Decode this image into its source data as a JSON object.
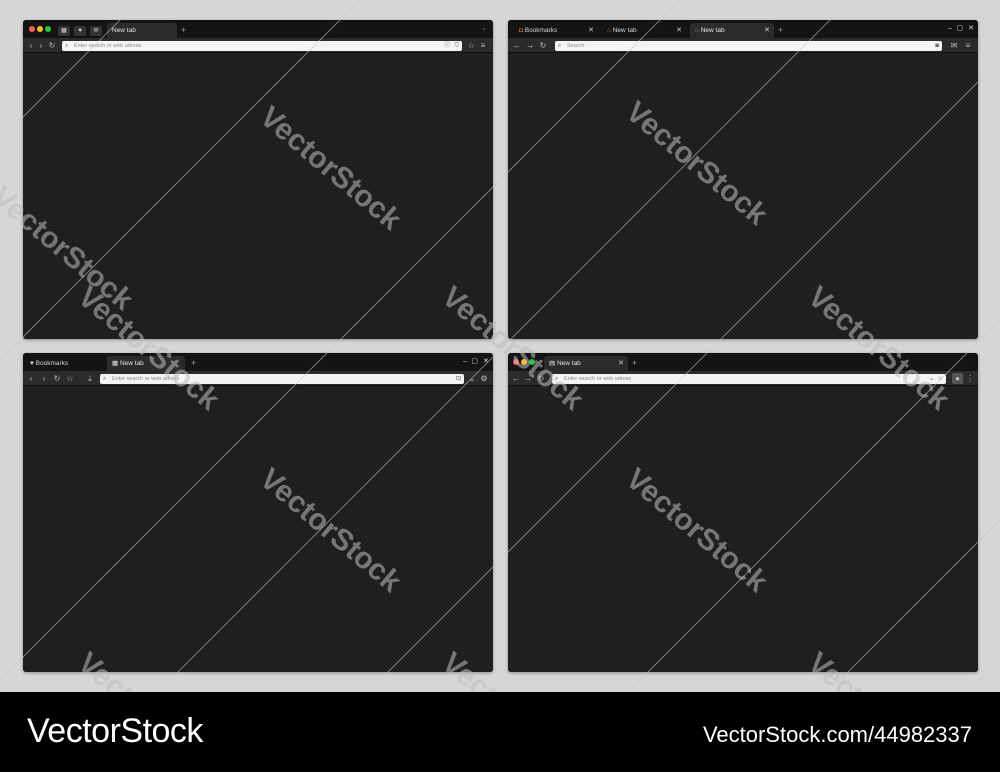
{
  "browsers": [
    {
      "tabs": [
        {
          "label": "New tab"
        }
      ],
      "address_placeholder": "Enter search or web adress"
    },
    {
      "tabs": [
        {
          "label": "Bookmarks"
        },
        {
          "label": "New tab"
        },
        {
          "label": "New tab"
        }
      ],
      "address_placeholder": "Search"
    },
    {
      "tabs": [
        {
          "label": "Bookmarks"
        },
        {
          "label": "New tab"
        }
      ],
      "address_placeholder": "Enter search or web adress"
    },
    {
      "tabs": [
        {
          "label": "New tab"
        }
      ],
      "address_placeholder": "Enter search or web adress"
    }
  ],
  "watermark": {
    "text": "VectorStock"
  },
  "footer": {
    "brand": "VectorStock",
    "image_id": "VectorStock.com/44982337"
  },
  "colors": {
    "window_bg": "#1f1f1f",
    "tabbar_bg": "#141414",
    "toolbar_bg": "#2b2b2b",
    "address_bg": "#f4f4f4",
    "mac_red": "#ff5f57",
    "mac_yellow": "#febc2e",
    "mac_green": "#28c840",
    "accent_orange": "#e8712b"
  }
}
